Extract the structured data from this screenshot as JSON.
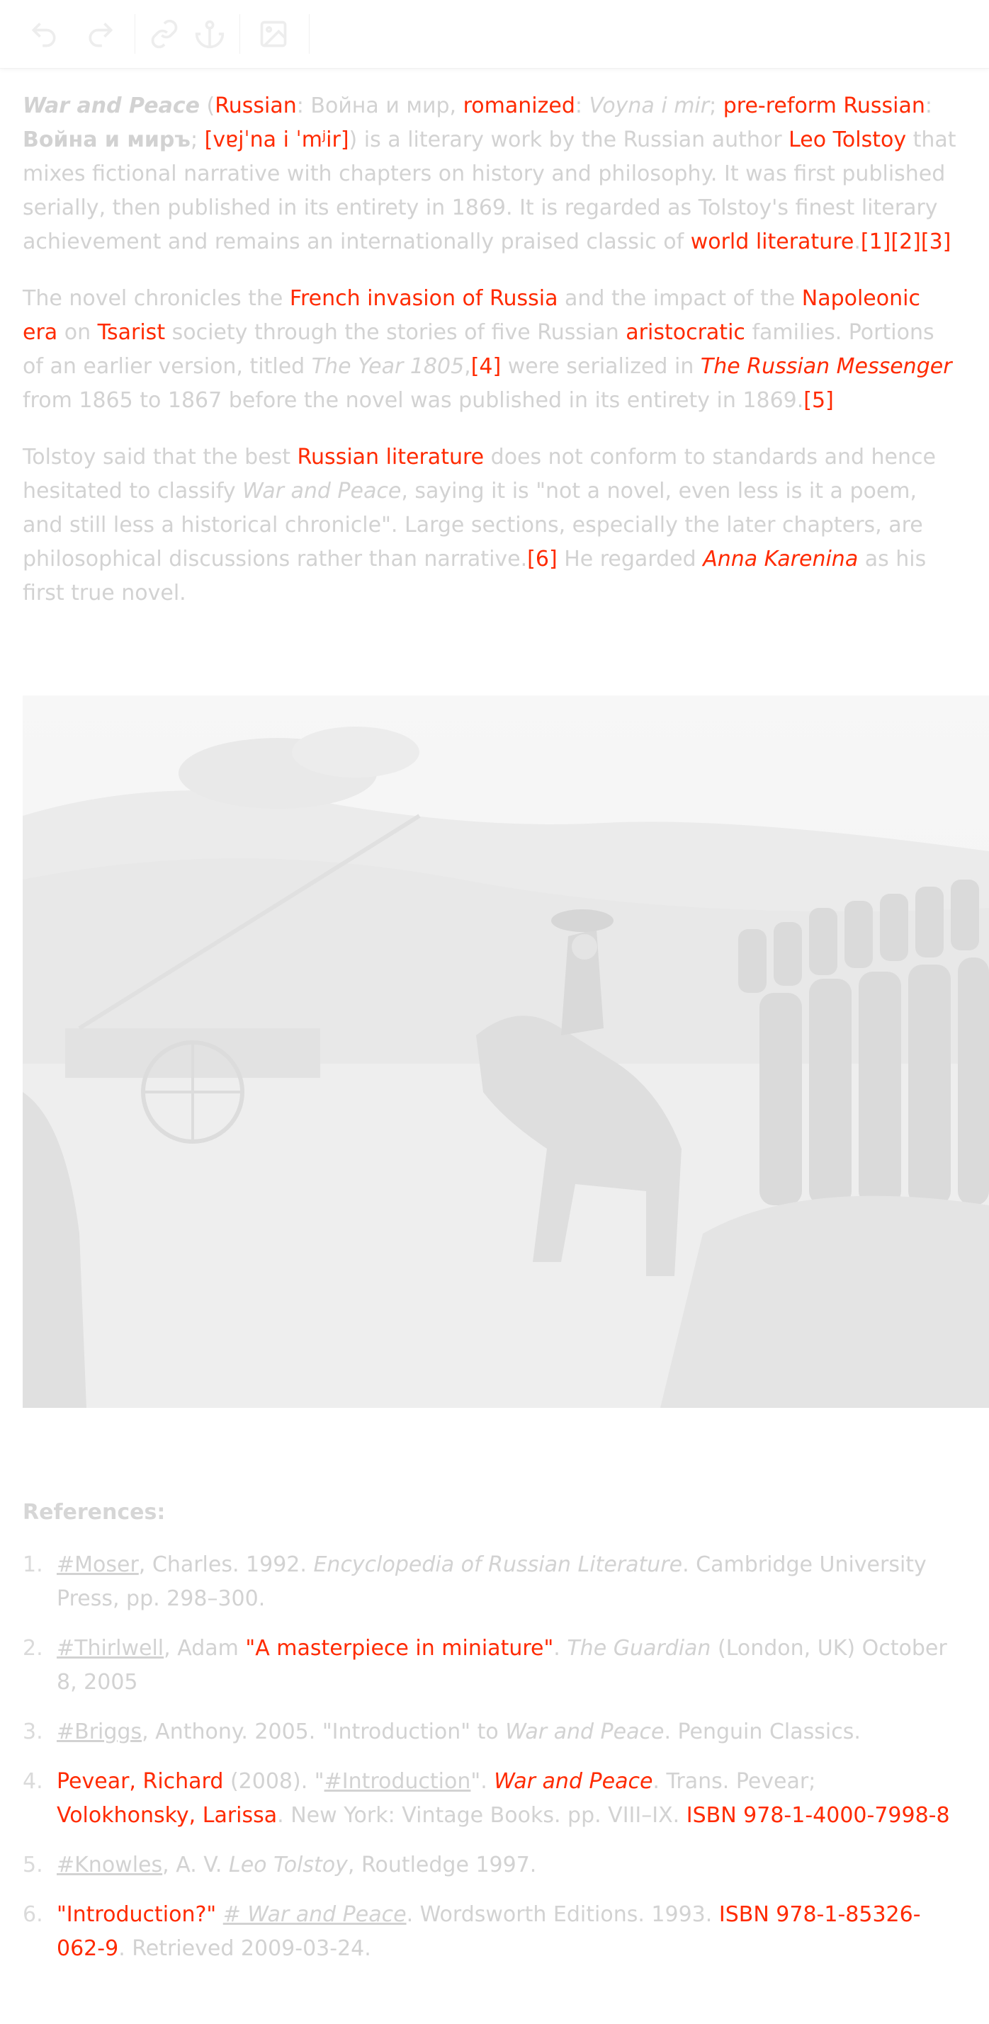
{
  "toolbar": {
    "icons": [
      "undo-icon",
      "redo-icon",
      "link-icon",
      "anchor-icon",
      "image-icon"
    ]
  },
  "article": {
    "p1": {
      "title": "War and Peace",
      "t1": " (",
      "russian": "Russian",
      "t2": ": Война и мир, ",
      "romanized": "romanized",
      "t3": ": ",
      "voyna": "Voyna i mir",
      "t4": "; ",
      "prereform": "pre-reform Russian",
      "t5": ": ",
      "old_title": "Война и миръ",
      "t6": "; ",
      "ipa": "[vɐjˈna i ˈmʲir]",
      "t7": ") is a literary work by the Russian author ",
      "tolstoy": "Leo Tolstoy",
      "t8": " that mixes fictional narrative with chapters on history and philosophy. It was first published serially, then published in its entirety in 1869. It is regarded as Tolstoy's finest literary achievement and remains an internationally praised classic of ",
      "worldlit": "world literature",
      "t9": ".",
      "ref1": "[1]",
      "ref2": "[2]",
      "ref3": "[3]"
    },
    "p2": {
      "t1": "The novel chronicles the ",
      "french": "French invasion of Russia",
      "t2": " and the impact of the ",
      "napoleonic": "Napoleonic era",
      "t3": " on ",
      "tsarist": "Tsarist",
      "t4": " society through the stories of five Russian ",
      "aristocratic": "aristocratic",
      "t5": " families. Portions of an earlier version, titled ",
      "year1805": "The Year 1805",
      "t6": ",",
      "ref4": "[4]",
      "t7": " were serialized in ",
      "messenger": "The Russian Messenger",
      "t8": " from 1865 to 1867 before the novel was published in its entirety in 1869.",
      "ref5": "[5]"
    },
    "p3": {
      "t1": "Tolstoy said that the best ",
      "ruslit": "Russian literature",
      "t2": " does not conform to standards and hence hesitated to classify ",
      "wp": "War and Peace",
      "t3": ", saying it is \"not a novel, even less is it a poem, and still less a historical chronicle\". Large sections, especially the later chapters, are philosophical discussions rather than narrative.",
      "ref6": "[6]",
      "t4": " He regarded ",
      "anna": "Anna Karenina",
      "t5": " as his first true novel."
    }
  },
  "references": {
    "heading": "References",
    "colon": ":",
    "items": [
      {
        "num": "1.",
        "a": "#Moser",
        "b": ", Charles. 1992. ",
        "c": "Encyclopedia of Russian Literature",
        "d": ". Cambridge University Press, pp. 298–300."
      },
      {
        "num": "2.",
        "a": "#Thirlwell",
        "b": ", Adam ",
        "c": "\"A masterpiece in miniature\"",
        "d": ". ",
        "e": "The Guardian",
        "f": " (London, UK) October 8, 2005"
      },
      {
        "num": "3.",
        "a": "#Briggs",
        "b": ", Anthony. 2005. \"Introduction\" to ",
        "c": "War and Peace",
        "d": ". Penguin Classics."
      },
      {
        "num": "4.",
        "a": "Pevear, Richard",
        "b": " (2008). \"",
        "c": "#Introduction",
        "d": "\". ",
        "e": "War and Peace",
        "f": ". Trans. Pevear; ",
        "g": "Volokhonsky, Larissa",
        "h": ". New York: Vintage Books. pp. VIII–IX. ",
        "i": "ISBN 978-1-4000-7998-8"
      },
      {
        "num": "5.",
        "a": "#Knowles",
        "b": ", A. V. ",
        "c": "Leo Tolstoy",
        "d": ", Routledge 1997."
      },
      {
        "num": "6.",
        "a": "\"Introduction?\"",
        "b": " ",
        "c": "# War and Peace",
        "d": ". Wordsworth Editions. 1993. ",
        "e": "ISBN 978-1-85326-062-9",
        "f": ". Retrieved 2009-03-24."
      }
    ]
  }
}
